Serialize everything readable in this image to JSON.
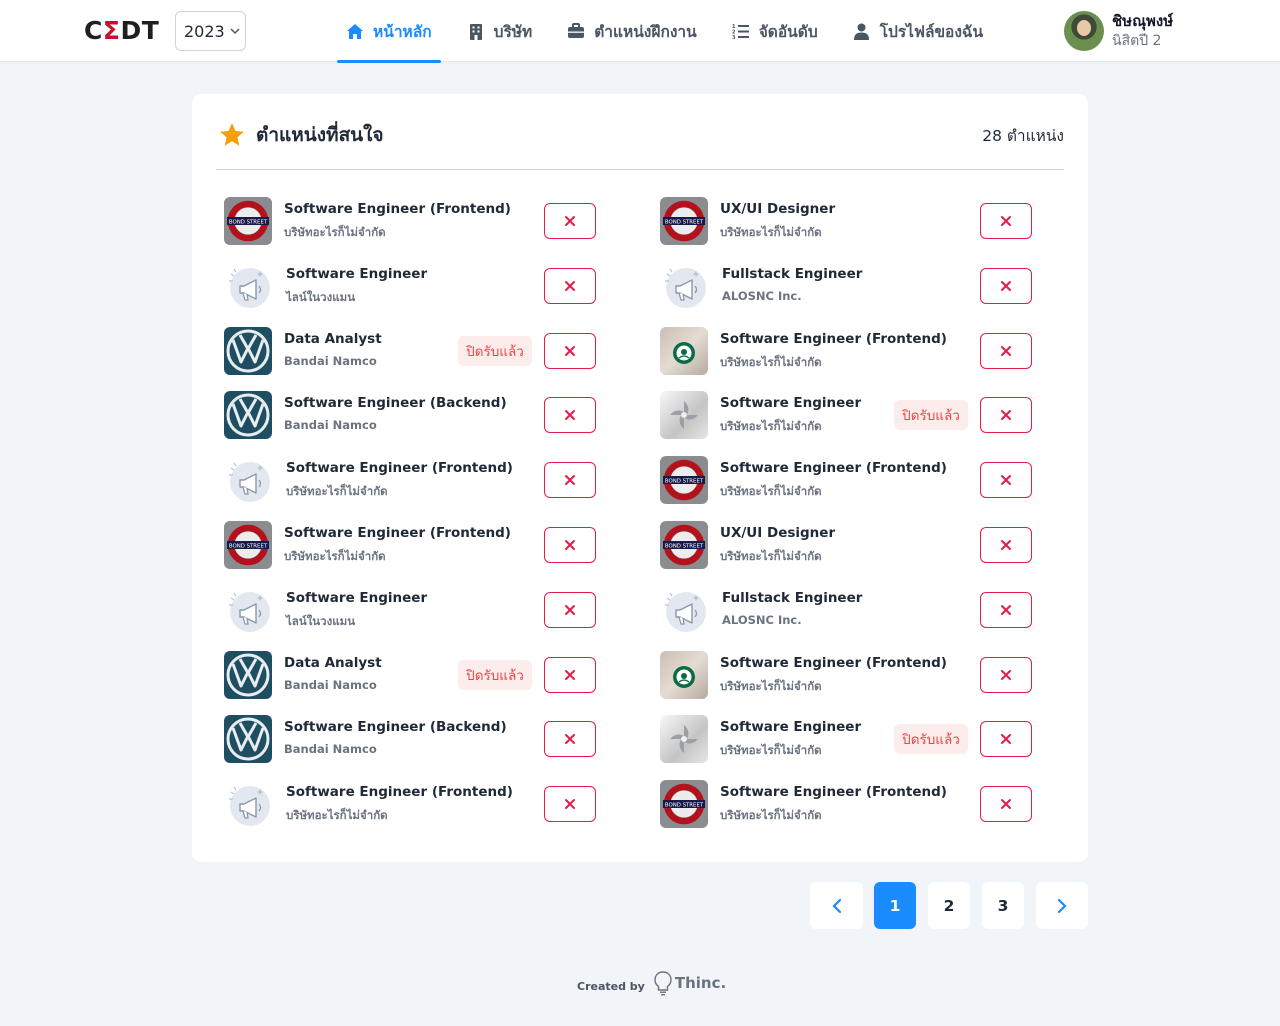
{
  "header": {
    "logo_left": "C",
    "logo_sigma": "Σ",
    "logo_right": "DT",
    "year": "2023",
    "nav": [
      {
        "label": "หน้าหลัก",
        "icon": "home-icon",
        "active": true
      },
      {
        "label": "บริษัท",
        "icon": "building-icon",
        "active": false
      },
      {
        "label": "ตำแหน่งฝึกงาน",
        "icon": "briefcase-icon",
        "active": false
      },
      {
        "label": "จัดอันดับ",
        "icon": "ranked-list-icon",
        "active": false
      },
      {
        "label": "โปรไฟล์ของฉัน",
        "icon": "user-icon",
        "active": false
      }
    ],
    "user": {
      "name": "ชิษณุพงษ์",
      "subtitle": "นิสิตปี 2"
    }
  },
  "card": {
    "title": "ตำแหน่งที่สนใจ",
    "count": "28 ตำแหน่ง",
    "closed_label": "ปิดรับแล้ว"
  },
  "jobs_left": [
    {
      "title": "Software Engineer (Frontend)",
      "company": "บริษัทอะไรก็ไม่จำกัด",
      "logo": "bond-street-logo",
      "closed": false
    },
    {
      "title": "Software Engineer",
      "company": "ไลน์ในวงแมน",
      "logo": "megaphone-placeholder",
      "closed": false
    },
    {
      "title": "Data Analyst",
      "company": "Bandai Namco",
      "logo": "vw-logo",
      "closed": true
    },
    {
      "title": "Software Engineer (Backend)",
      "company": "Bandai Namco",
      "logo": "vw-logo",
      "closed": false
    },
    {
      "title": "Software Engineer (Frontend)",
      "company": "บริษัทอะไรก็ไม่จำกัด",
      "logo": "megaphone-placeholder",
      "closed": false
    },
    {
      "title": "Software Engineer (Frontend)",
      "company": "บริษัทอะไรก็ไม่จำกัด",
      "logo": "bond-street-logo",
      "closed": false
    },
    {
      "title": "Software Engineer",
      "company": "ไลน์ในวงแมน",
      "logo": "megaphone-placeholder",
      "closed": false
    },
    {
      "title": "Data Analyst",
      "company": "Bandai Namco",
      "logo": "vw-logo",
      "closed": true
    },
    {
      "title": "Software Engineer (Backend)",
      "company": "Bandai Namco",
      "logo": "vw-logo",
      "closed": false
    },
    {
      "title": "Software Engineer (Frontend)",
      "company": "บริษัทอะไรก็ไม่จำกัด",
      "logo": "megaphone-placeholder",
      "closed": false
    }
  ],
  "jobs_right": [
    {
      "title": "UX/UI Designer",
      "company": "บริษัทอะไรก็ไม่จำกัด",
      "logo": "bond-street-logo",
      "closed": false
    },
    {
      "title": "Fullstack Engineer",
      "company": "ALOSNC Inc.",
      "logo": "megaphone-placeholder",
      "closed": false
    },
    {
      "title": "Software Engineer (Frontend)",
      "company": "บริษัทอะไรก็ไม่จำกัด",
      "logo": "starbucks-logo",
      "closed": false
    },
    {
      "title": "Software Engineer",
      "company": "บริษัทอะไรก็ไม่จำกัด",
      "logo": "metal-swirl-logo",
      "closed": true
    },
    {
      "title": "Software Engineer (Frontend)",
      "company": "บริษัทอะไรก็ไม่จำกัด",
      "logo": "bond-street-logo",
      "closed": false
    },
    {
      "title": "UX/UI Designer",
      "company": "บริษัทอะไรก็ไม่จำกัด",
      "logo": "bond-street-logo",
      "closed": false
    },
    {
      "title": "Fullstack Engineer",
      "company": "ALOSNC Inc.",
      "logo": "megaphone-placeholder",
      "closed": false
    },
    {
      "title": "Software Engineer (Frontend)",
      "company": "บริษัทอะไรก็ไม่จำกัด",
      "logo": "starbucks-logo",
      "closed": false
    },
    {
      "title": "Software Engineer",
      "company": "บริษัทอะไรก็ไม่จำกัด",
      "logo": "metal-swirl-logo",
      "closed": true
    },
    {
      "title": "Software Engineer (Frontend)",
      "company": "บริษัทอะไรก็ไม่จำกัด",
      "logo": "bond-street-logo",
      "closed": false
    }
  ],
  "pagination": {
    "pages": [
      "1",
      "2",
      "3"
    ],
    "current": "1"
  },
  "footer": {
    "created_by": "Created by",
    "brand": "Thinc."
  },
  "colors": {
    "accent": "#1a8cff",
    "danger": "#e11d48",
    "star": "#f59e0b"
  }
}
